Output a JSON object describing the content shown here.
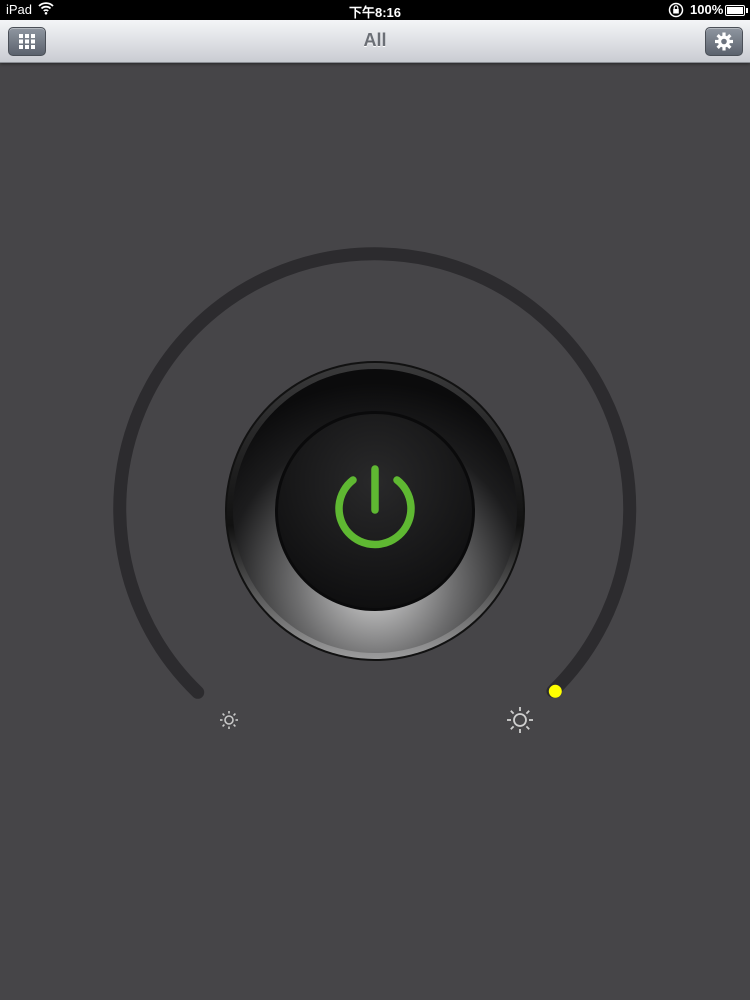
{
  "status_bar": {
    "carrier": "iPad",
    "time": "下午8:16",
    "battery": "100%"
  },
  "nav": {
    "title": "All",
    "left_icon": "grid-icon",
    "right_icon": "gear-icon"
  },
  "dial": {
    "level": 1.0,
    "power_state": "on",
    "min_icon": "sun-dim-icon",
    "max_icon": "sun-bright-icon",
    "colors": {
      "power": "#5fb832",
      "knob_indicator": "#ffff00",
      "track": "#2e2d30"
    }
  }
}
